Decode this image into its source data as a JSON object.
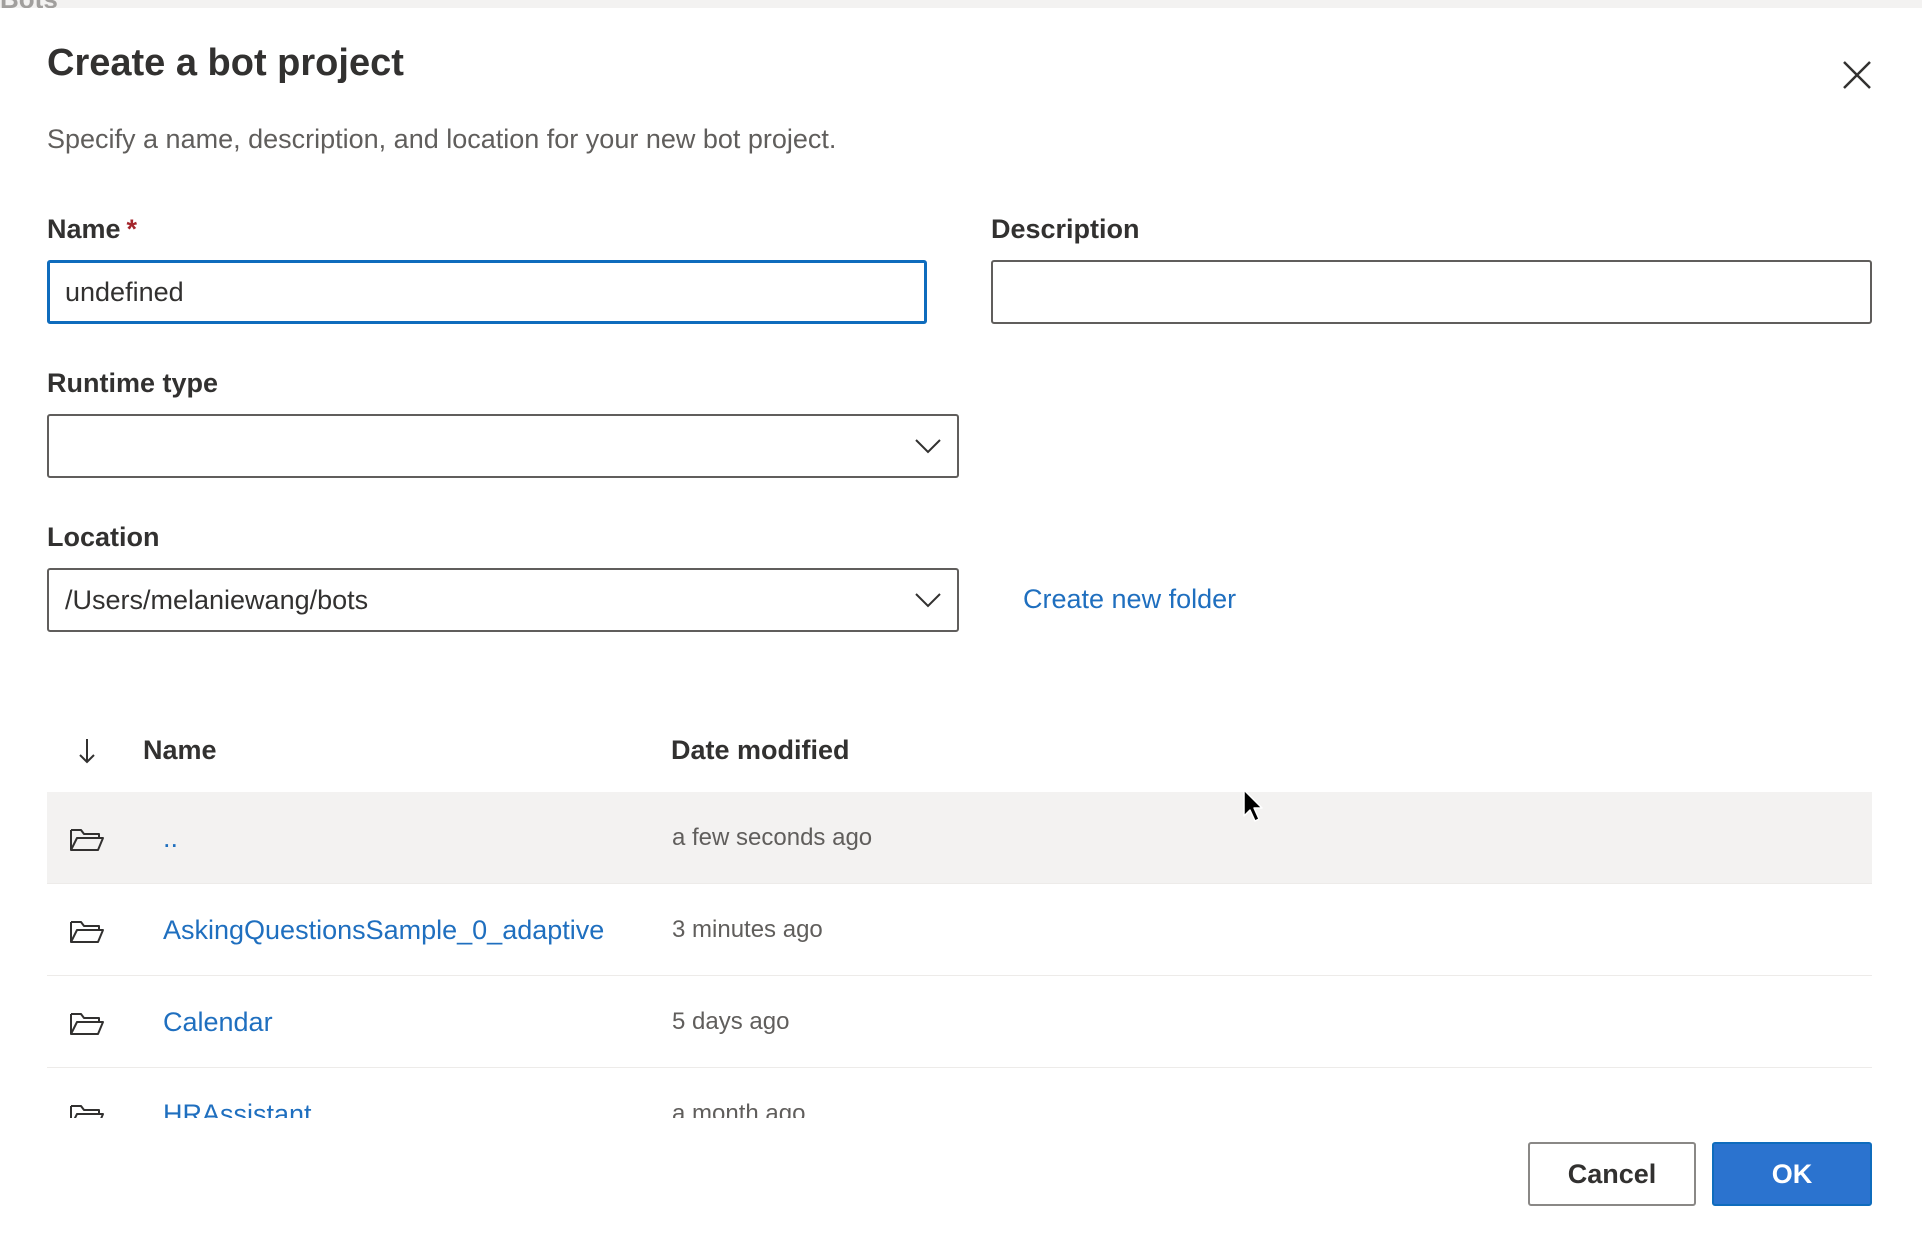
{
  "background": {
    "partial_text": "Bots"
  },
  "dialog": {
    "title": "Create a bot project",
    "subtitle": "Specify a name, description, and location for your new bot project."
  },
  "form": {
    "name": {
      "label": "Name",
      "required_mark": "*",
      "value": "undefined"
    },
    "description": {
      "label": "Description",
      "value": ""
    },
    "runtime": {
      "label": "Runtime type",
      "value": ""
    },
    "location": {
      "label": "Location",
      "value": "/Users/melaniewang/bots"
    },
    "create_folder_link": "Create new folder"
  },
  "file_list": {
    "columns": {
      "name": "Name",
      "date": "Date modified"
    },
    "rows": [
      {
        "name": "..",
        "date": "a few seconds ago"
      },
      {
        "name": "AskingQuestionsSample_0_adaptive",
        "date": "3 minutes ago"
      },
      {
        "name": "Calendar",
        "date": "5 days ago"
      },
      {
        "name": "HRAssistant",
        "date": "a month ago"
      }
    ]
  },
  "footer": {
    "cancel_label": "Cancel",
    "ok_label": "OK"
  },
  "colors": {
    "accent": "#2b73cf",
    "focus_border": "#0f6cbd",
    "link": "#1f6fbf",
    "required": "#a4262c"
  }
}
